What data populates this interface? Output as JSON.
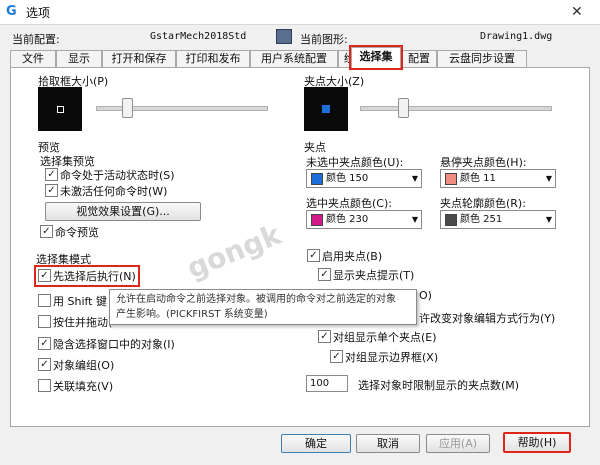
{
  "window": {
    "title": "选项",
    "app_icon": "G",
    "close": "✕"
  },
  "header": {
    "current_config_label": "当前配置:",
    "current_config_value": "GstarMech2018Std",
    "current_drawing_label": "当前图形:",
    "current_drawing_value": "Drawing1.dwg"
  },
  "tabs": [
    "文件",
    "显示",
    "打开和保存",
    "打印和发布",
    "用户系统配置",
    "绘图",
    "选择集",
    "配置",
    "云盘同步设置"
  ],
  "active_tab": "选择集",
  "left": {
    "pickbox_label": "拾取框大小(P)",
    "preview_group": "预览",
    "selection_preview": "选择集预览",
    "when_command_active": "命令处于活动状态时(S)",
    "when_no_command": "未激活任何命令时(W)",
    "visual_effects_button": "视觉效果设置(G)...",
    "command_preview": "命令预览",
    "selection_modes_group": "选择集模式",
    "noun_verb": "先选择后执行(N)",
    "shift_add": "用 Shift 键",
    "press_drag": "按住并拖动(",
    "implied_window": "隐含选择窗口中的对象(I)",
    "object_grouping": "对象编组(O)",
    "associative_hatch": "关联填充(V)"
  },
  "tooltip": {
    "line1": "允许在启动命令之前选择对象。被调用的命令对之前选定的对象",
    "line2": "产生影响。(PICKFIRST 系统变量)"
  },
  "right": {
    "grip_size_label": "夹点大小(Z)",
    "grips_group": "夹点",
    "unselected_color_label": "未选中夹点颜色(U):",
    "unselected_color": {
      "name": "颜色 150",
      "hex": "#1c6fd6"
    },
    "hover_color_label": "悬停夹点颜色(H):",
    "hover_color": {
      "name": "颜色 11",
      "hex": "#f08c80"
    },
    "selected_color_label": "选中夹点颜色(C):",
    "selected_color": {
      "name": "颜色 230",
      "hex": "#d21a8a"
    },
    "contour_color_label": "夹点轮廓颜色(R):",
    "contour_color": {
      "name": "颜色 251",
      "hex": "#4a4a4a"
    },
    "enable_grips": "启用夹点(B)",
    "show_grip_tips": "显示夹点提示(T)",
    "partial_row_a": "O)",
    "partial_row_b": "许改变对象编辑方式行为(Y)",
    "group_single_grip": "对组显示单个夹点(E)",
    "group_bbox": "对组显示边界框(X)",
    "limit_value": "100",
    "limit_label": "选择对象时限制显示的夹点数(M)"
  },
  "footer": {
    "ok": "确定",
    "cancel": "取消",
    "apply": "应用(A)",
    "help": "帮助(H)"
  },
  "watermark": "gongk",
  "checkbox_states": {
    "when_command_active": true,
    "when_no_command": true,
    "command_preview": true,
    "noun_verb": true,
    "shift_add": false,
    "press_drag": false,
    "implied_window": true,
    "object_grouping": true,
    "associative_hatch": false,
    "enable_grips": true,
    "show_grip_tips": true,
    "partial_row_a": false,
    "partial_row_b": false,
    "group_single_grip": true,
    "group_bbox": true
  }
}
